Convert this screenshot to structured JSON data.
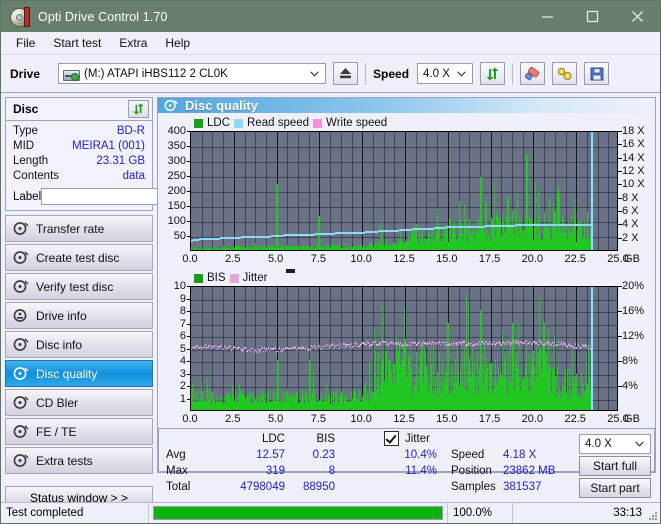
{
  "window": {
    "title": "Opti Drive Control 1.70",
    "icon": "disc-icon",
    "minimize": "–",
    "maximize": "□",
    "close": "✕"
  },
  "menu": {
    "items": [
      "File",
      "Start test",
      "Extra",
      "Help"
    ]
  },
  "toolbar": {
    "drive_label": "Drive",
    "drive_value": "(M:)  ATAPI iHBS112  2 CL0K",
    "eject_icon": "eject-icon",
    "speed_label": "Speed",
    "speed_value": "4.0 X",
    "refresh_icon": "refresh-icon",
    "erase_icon": "eraser-icon",
    "tools_icon": "tools-icon",
    "save_icon": "save-icon"
  },
  "disc_panel": {
    "title": "Disc",
    "refresh_icon": "refresh-icon",
    "rows": [
      {
        "key": "Type",
        "value": "BD-R"
      },
      {
        "key": "MID",
        "value": "MEIRA1 (001)"
      },
      {
        "key": "Length",
        "value": "23.31 GB"
      },
      {
        "key": "Contents",
        "value": "data"
      }
    ],
    "label_key": "Label",
    "label_value": "",
    "label_placeholder": "",
    "label_button_icon": "cd-icon"
  },
  "sidebar": {
    "items": [
      {
        "label": "Transfer rate",
        "icon": "disc-icon",
        "selected": false
      },
      {
        "label": "Create test disc",
        "icon": "disc-icon",
        "selected": false
      },
      {
        "label": "Verify test disc",
        "icon": "disc-icon",
        "selected": false
      },
      {
        "label": "Drive info",
        "icon": "drive-icon",
        "selected": false
      },
      {
        "label": "Disc info",
        "icon": "disc-icon",
        "selected": false
      },
      {
        "label": "Disc quality",
        "icon": "disc-icon",
        "selected": true
      },
      {
        "label": "CD Bler",
        "icon": "disc-icon",
        "selected": false
      },
      {
        "label": "FE / TE",
        "icon": "disc-icon",
        "selected": false
      },
      {
        "label": "Extra tests",
        "icon": "disc-icon",
        "selected": false
      }
    ],
    "status_window_button": "Status window > >"
  },
  "content": {
    "header_icon": "disc-quality-icon",
    "header_title": "Disc quality"
  },
  "stats": {
    "col_headers": [
      "LDC",
      "BIS"
    ],
    "row_labels": [
      "Avg",
      "Max",
      "Total"
    ],
    "ldc": {
      "avg": "12.57",
      "max": "319",
      "total": "4798049"
    },
    "bis": {
      "avg": "0.23",
      "max": "8",
      "total": "88950"
    },
    "jitter": {
      "label": "Jitter",
      "checked": true,
      "avg": "10.4%",
      "max": "11.4%"
    },
    "speed_label": "Speed",
    "speed_value": "4.18 X",
    "position_label": "Position",
    "position_value": "23862 MB",
    "samples_label": "Samples",
    "samples_value": "381537",
    "speed_select": "4.0 X",
    "start_full": "Start full",
    "start_part": "Start part"
  },
  "statusbar": {
    "message": "Test completed",
    "progress_text": "100.0%",
    "progress_percent": 100,
    "elapsed": "33:13"
  },
  "chart_data": [
    {
      "type": "area",
      "id": "ldc-chart",
      "title": "",
      "legend": [
        {
          "label": "LDC",
          "color": "#1a9e1a"
        },
        {
          "label": "Read speed",
          "color": "#8fd9f5"
        },
        {
          "label": "Write speed",
          "color": "#f58fd9"
        }
      ],
      "legend_position": "top-left",
      "xlabel": "GB",
      "ylabel": "",
      "xlim": [
        0,
        25
      ],
      "ylim": [
        0,
        400
      ],
      "y2lim": [
        0,
        18
      ],
      "y2label": "X",
      "xticks": [
        "0.0",
        "2.5",
        "5.0",
        "7.5",
        "10.0",
        "12.5",
        "15.0",
        "17.5",
        "20.0",
        "22.5",
        "25.0"
      ],
      "yticks": [
        50,
        100,
        150,
        200,
        250,
        300,
        350,
        400
      ],
      "y2ticks": [
        "2 X",
        "4 X",
        "6 X",
        "8 X",
        "10 X",
        "12 X",
        "14 X",
        "16 X",
        "18 X"
      ],
      "grid": true,
      "cursor_x": 23.35,
      "series": [
        {
          "name": "Read speed",
          "color": "#8fd9f5",
          "axis": "right",
          "x": [
            0.0,
            0.5,
            1.0,
            1.5,
            2.0,
            2.5,
            3.0,
            3.5,
            4.0,
            4.5,
            5.0,
            5.5,
            6.0,
            6.5,
            7.0,
            7.5,
            8.0,
            8.5,
            9.0,
            9.5,
            10.0,
            10.5,
            11.0,
            11.5,
            12.0,
            12.5,
            13.0,
            13.5,
            14.0,
            14.5,
            15.0,
            15.5,
            16.0,
            16.5,
            17.0,
            17.5,
            18.0,
            18.5,
            19.0,
            19.5,
            20.0,
            20.5,
            21.0,
            21.5,
            22.0,
            22.5,
            23.0,
            23.35
          ],
          "values": [
            1.7,
            1.9,
            2.0,
            2.0,
            2.1,
            2.1,
            2.2,
            2.2,
            2.3,
            2.3,
            2.4,
            2.5,
            2.5,
            2.6,
            2.6,
            2.7,
            2.7,
            2.8,
            2.8,
            2.9,
            2.9,
            3.0,
            3.1,
            3.2,
            3.2,
            3.3,
            3.4,
            3.5,
            3.5,
            3.6,
            3.7,
            3.7,
            3.8,
            3.8,
            3.8,
            3.9,
            3.9,
            3.9,
            4.0,
            4.0,
            4.0,
            4.1,
            4.1,
            4.1,
            4.1,
            4.1,
            4.1,
            4.1
          ]
        },
        {
          "name": "LDC",
          "color": "#23c723",
          "axis": "left",
          "note": "dense per-sample error counts; baseline rises from ~5 near 0GB to ~80 near 21GB",
          "baseline_x": [
            0,
            2,
            4,
            6,
            8,
            10,
            11,
            12,
            13,
            14,
            15,
            16,
            17,
            18,
            19,
            20,
            21,
            22,
            23,
            23.35
          ],
          "baseline_values": [
            6,
            8,
            9,
            10,
            12,
            15,
            20,
            28,
            38,
            48,
            56,
            62,
            70,
            76,
            80,
            82,
            84,
            70,
            55,
            40
          ],
          "peaks": [
            {
              "x": 5.0,
              "value": 219
            },
            {
              "x": 7.45,
              "value": 112
            },
            {
              "x": 11.1,
              "value": 98
            },
            {
              "x": 13.1,
              "value": 86
            },
            {
              "x": 15.1,
              "value": 106
            },
            {
              "x": 16.9,
              "value": 243
            },
            {
              "x": 17.2,
              "value": 160
            },
            {
              "x": 18.5,
              "value": 176
            },
            {
              "x": 19.6,
              "value": 318
            },
            {
              "x": 21.4,
              "value": 206
            },
            {
              "x": 21.5,
              "value": 190
            },
            {
              "x": 22.6,
              "value": 95
            }
          ]
        }
      ]
    },
    {
      "type": "area",
      "id": "bis-chart",
      "title": "",
      "legend": [
        {
          "label": "BIS",
          "color": "#1a9e1a"
        },
        {
          "label": "Jitter",
          "color": "#e0a8de"
        }
      ],
      "legend_position": "top-left",
      "xlabel": "GB",
      "ylabel": "",
      "xlim": [
        0,
        25
      ],
      "ylim": [
        0,
        10
      ],
      "y2lim": [
        0,
        20
      ],
      "y2label": "%",
      "xticks": [
        "0.0",
        "2.5",
        "5.0",
        "7.5",
        "10.0",
        "12.5",
        "15.0",
        "17.5",
        "20.0",
        "22.5",
        "25.0"
      ],
      "yticks": [
        1,
        2,
        3,
        4,
        5,
        6,
        7,
        8,
        9,
        10
      ],
      "y2ticks": [
        "4%",
        "8%",
        "12%",
        "16%",
        "20%"
      ],
      "grid": true,
      "cursor_x": 23.35,
      "series": [
        {
          "name": "Jitter",
          "color": "#e0a8de",
          "axis": "right",
          "x": [
            0.0,
            0.5,
            1.0,
            1.5,
            2.0,
            2.5,
            3.0,
            3.5,
            4.0,
            4.5,
            5.0,
            5.5,
            6.0,
            6.5,
            7.0,
            7.5,
            8.0,
            8.5,
            9.0,
            9.5,
            10.0,
            10.5,
            11.0,
            11.5,
            12.0,
            12.5,
            13.0,
            13.5,
            14.0,
            14.5,
            15.0,
            15.5,
            16.0,
            16.5,
            17.0,
            17.5,
            18.0,
            18.5,
            19.0,
            19.5,
            20.0,
            20.5,
            21.0,
            21.5,
            22.0,
            22.5,
            23.0,
            23.35
          ],
          "values": [
            10.1,
            10.3,
            10.4,
            10.3,
            10.3,
            10.2,
            10.0,
            9.9,
            9.9,
            9.9,
            9.9,
            10.0,
            10.1,
            10.1,
            10.2,
            10.3,
            10.5,
            10.5,
            10.6,
            10.7,
            10.8,
            10.9,
            11.0,
            11.0,
            10.9,
            10.8,
            10.9,
            10.9,
            11.0,
            10.9,
            10.9,
            10.9,
            10.9,
            10.8,
            10.9,
            11.0,
            11.0,
            11.0,
            11.1,
            11.0,
            11.0,
            11.0,
            10.9,
            10.9,
            10.6,
            10.5,
            10.4,
            10.3
          ]
        },
        {
          "name": "BIS",
          "color": "#23c723",
          "axis": "left",
          "note": "per-sample burst indicator counts; baseline ~1 to 10.5GB, ~3 to 21.5GB, spikes to 8",
          "baseline_x": [
            0,
            2,
            4,
            6,
            8,
            10,
            10.6,
            11,
            12,
            13,
            14,
            15,
            16,
            17,
            18,
            19,
            20,
            21,
            21.5,
            22,
            23,
            23.35
          ],
          "baseline_values": [
            1,
            1,
            1,
            1,
            1,
            1,
            3,
            3,
            3,
            3,
            3,
            3,
            3,
            3,
            3,
            3,
            3,
            3,
            2,
            2,
            2,
            2
          ],
          "peaks": [
            {
              "x": 5.05,
              "value": 4
            },
            {
              "x": 6.9,
              "value": 4
            },
            {
              "x": 11.6,
              "value": 4
            },
            {
              "x": 12.3,
              "value": 4
            },
            {
              "x": 15.0,
              "value": 7
            },
            {
              "x": 16.9,
              "value": 8
            },
            {
              "x": 18.8,
              "value": 7
            },
            {
              "x": 19.1,
              "value": 7
            },
            {
              "x": 20.6,
              "value": 7
            },
            {
              "x": 21.2,
              "value": 6
            }
          ]
        }
      ]
    }
  ]
}
